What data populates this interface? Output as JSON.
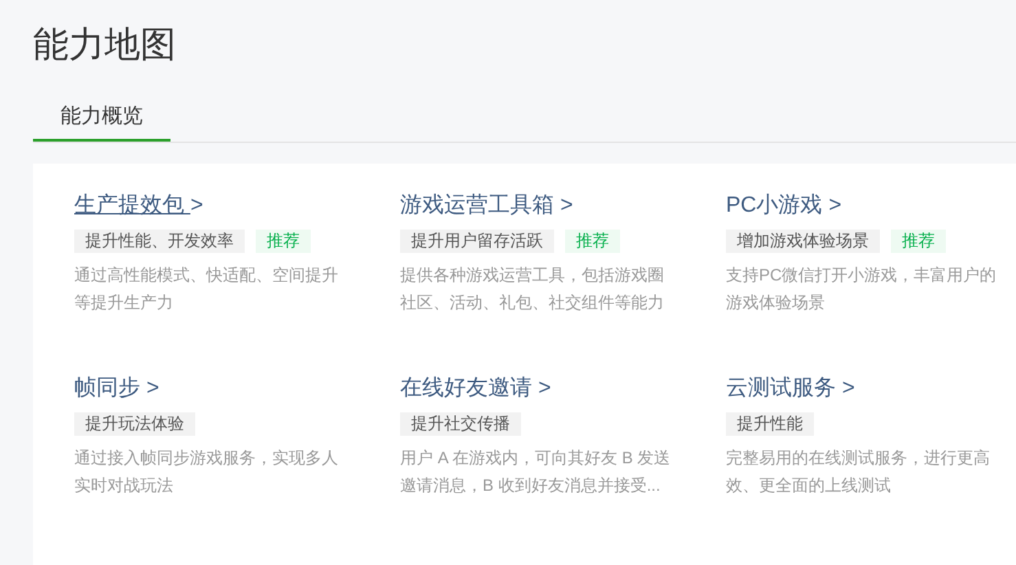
{
  "page_title": "能力地图",
  "tabs": [
    {
      "label": "能力概览",
      "selected": true
    }
  ],
  "cards": [
    {
      "title": "生产提效包",
      "arrow": ">",
      "hovered": true,
      "tags": [
        {
          "label": "提升性能、开发效率",
          "kind": "plain"
        },
        {
          "label": "推荐",
          "kind": "recommend"
        }
      ],
      "description": "通过高性能模式、快适配、空间提升等提升生产力"
    },
    {
      "title": "游戏运营工具箱",
      "arrow": ">",
      "hovered": false,
      "tags": [
        {
          "label": "提升用户留存活跃",
          "kind": "plain"
        },
        {
          "label": "推荐",
          "kind": "recommend"
        }
      ],
      "description": "提供各种游戏运营工具，包括游戏圈社区、活动、礼包、社交组件等能力"
    },
    {
      "title": "PC小游戏",
      "arrow": ">",
      "hovered": false,
      "tags": [
        {
          "label": "增加游戏体验场景",
          "kind": "plain"
        },
        {
          "label": "推荐",
          "kind": "recommend"
        }
      ],
      "description": "支持PC微信打开小游戏，丰富用户的游戏体验场景"
    },
    {
      "title": "帧同步",
      "arrow": ">",
      "hovered": false,
      "tags": [
        {
          "label": "提升玩法体验",
          "kind": "plain"
        }
      ],
      "description": "通过接入帧同步游戏服务，实现多人实时对战玩法"
    },
    {
      "title": "在线好友邀请",
      "arrow": ">",
      "hovered": false,
      "tags": [
        {
          "label": "提升社交传播",
          "kind": "plain"
        }
      ],
      "description": "用户 A 在游戏内，可向其好友 B 发送邀请消息，B 收到好友消息并接受..."
    },
    {
      "title": "云测试服务",
      "arrow": ">",
      "hovered": false,
      "tags": [
        {
          "label": "提升性能",
          "kind": "plain"
        }
      ],
      "description": "完整易用的在线测试服务，进行更高效、更全面的上线测试"
    }
  ]
}
